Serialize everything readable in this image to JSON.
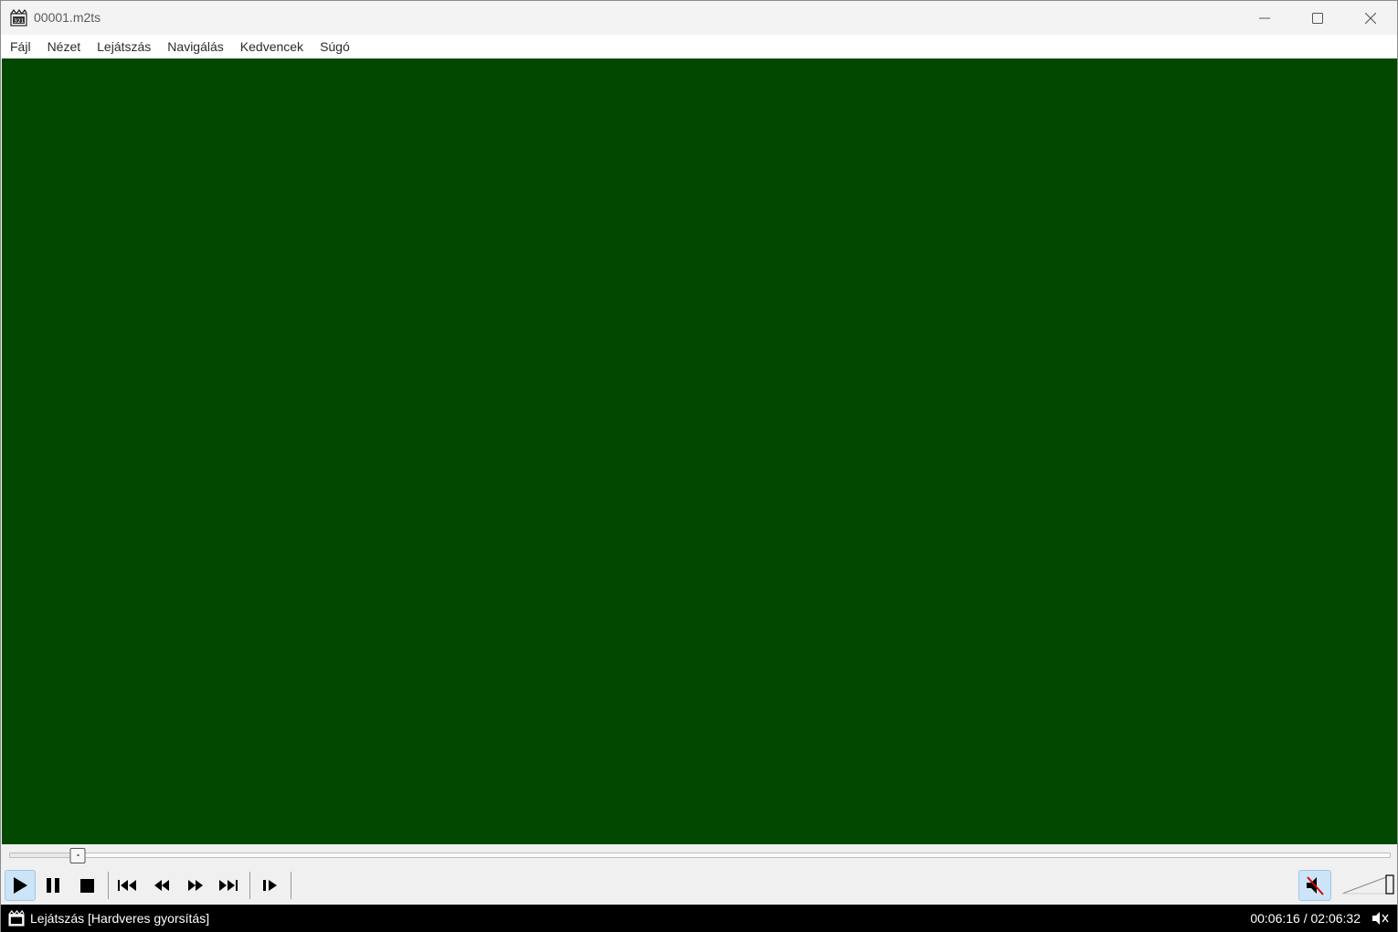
{
  "window": {
    "title": "00001.m2ts"
  },
  "menu": {
    "items": [
      {
        "label": "Fájl"
      },
      {
        "label": "Nézet"
      },
      {
        "label": "Lejátszás"
      },
      {
        "label": "Navigálás"
      },
      {
        "label": "Kedvencek"
      },
      {
        "label": "Súgó"
      }
    ]
  },
  "video": {
    "background": "#034801"
  },
  "seek": {
    "position_fraction": 0.0499
  },
  "toolbar": {
    "buttons": [
      {
        "icon": "play-icon",
        "active": true
      },
      {
        "icon": "pause-icon"
      },
      {
        "icon": "stop-icon"
      },
      {
        "icon": "skip-previous-icon"
      },
      {
        "icon": "rewind-icon"
      },
      {
        "icon": "fast-forward-icon"
      },
      {
        "icon": "skip-next-icon"
      },
      {
        "icon": "frame-step-icon"
      },
      {
        "icon": "mute-icon",
        "active": true
      }
    ],
    "volume_fraction": 1.0
  },
  "status": {
    "text": "Lejátszás [Hardveres gyorsítás]",
    "time": "00:06:16 / 02:06:32"
  },
  "colors": {
    "accent": "#cce4f7",
    "statusbar": "#000000"
  }
}
